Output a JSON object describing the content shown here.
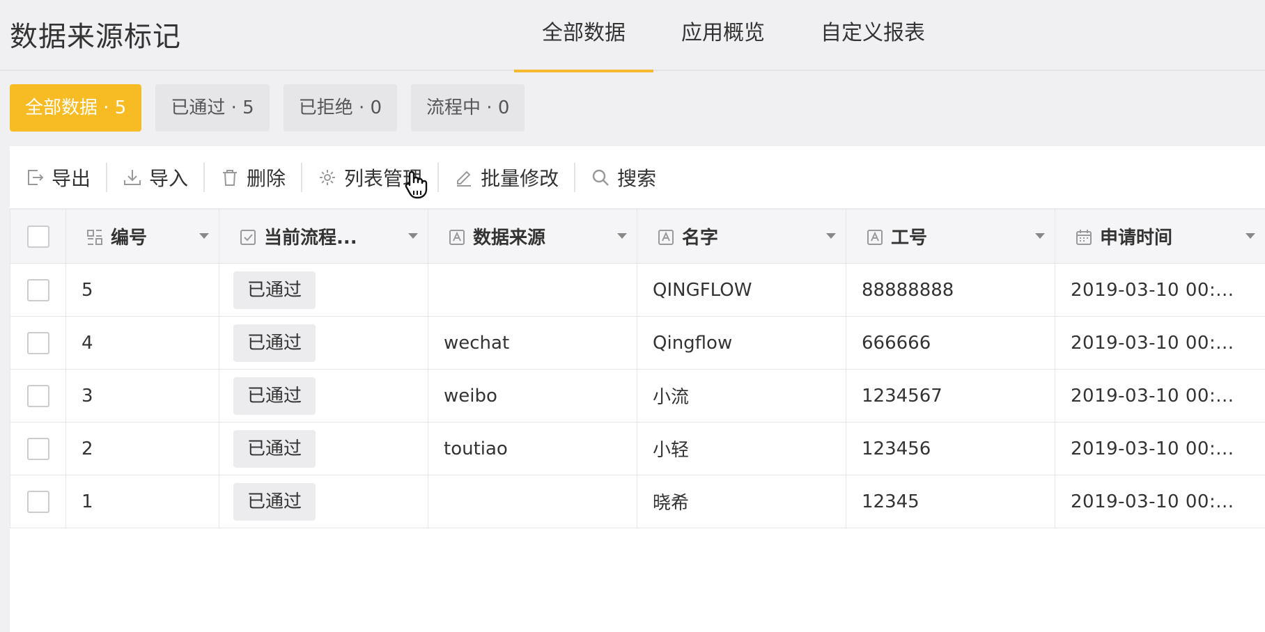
{
  "app": {
    "title": "数据来源标记"
  },
  "tabs": [
    {
      "label": "全部数据",
      "active": true
    },
    {
      "label": "应用概览",
      "active": false
    },
    {
      "label": "自定义报表",
      "active": false
    }
  ],
  "filters": [
    {
      "label": "全部数据 · 5",
      "active": true
    },
    {
      "label": "已通过 · 5",
      "active": false
    },
    {
      "label": "已拒绝 · 0",
      "active": false
    },
    {
      "label": "流程中 · 0",
      "active": false
    }
  ],
  "toolbar": {
    "export_label": "导出",
    "import_label": "导入",
    "delete_label": "删除",
    "columns_label": "列表管理",
    "batch_edit_label": "批量修改",
    "search_label": "搜索"
  },
  "table": {
    "columns": [
      {
        "label": "编号",
        "icon": "serial-number-icon"
      },
      {
        "label": "当前流程...",
        "icon": "checkbox-field-icon"
      },
      {
        "label": "数据来源",
        "icon": "text-field-icon"
      },
      {
        "label": "名字",
        "icon": "text-field-icon"
      },
      {
        "label": "工号",
        "icon": "text-field-icon"
      },
      {
        "label": "申请时间",
        "icon": "calendar-icon"
      }
    ],
    "rows": [
      {
        "id": "5",
        "status": "已通过",
        "source": "",
        "name": "QINGFLOW",
        "emp_no": "88888888",
        "time": "2019-03-10 00:..."
      },
      {
        "id": "4",
        "status": "已通过",
        "source": "wechat",
        "name": "Qingflow",
        "emp_no": "666666",
        "time": "2019-03-10 00:..."
      },
      {
        "id": "3",
        "status": "已通过",
        "source": "weibo",
        "name": "小流",
        "emp_no": "1234567",
        "time": "2019-03-10 00:..."
      },
      {
        "id": "2",
        "status": "已通过",
        "source": "toutiao",
        "name": "小轻",
        "emp_no": "123456",
        "time": "2019-03-10 00:..."
      },
      {
        "id": "1",
        "status": "已通过",
        "source": "",
        "name": "晓希",
        "emp_no": "12345",
        "time": "2019-03-10 00:..."
      }
    ]
  },
  "colors": {
    "accent": "#f7bc24",
    "tab_underline": "#f5b82e"
  }
}
